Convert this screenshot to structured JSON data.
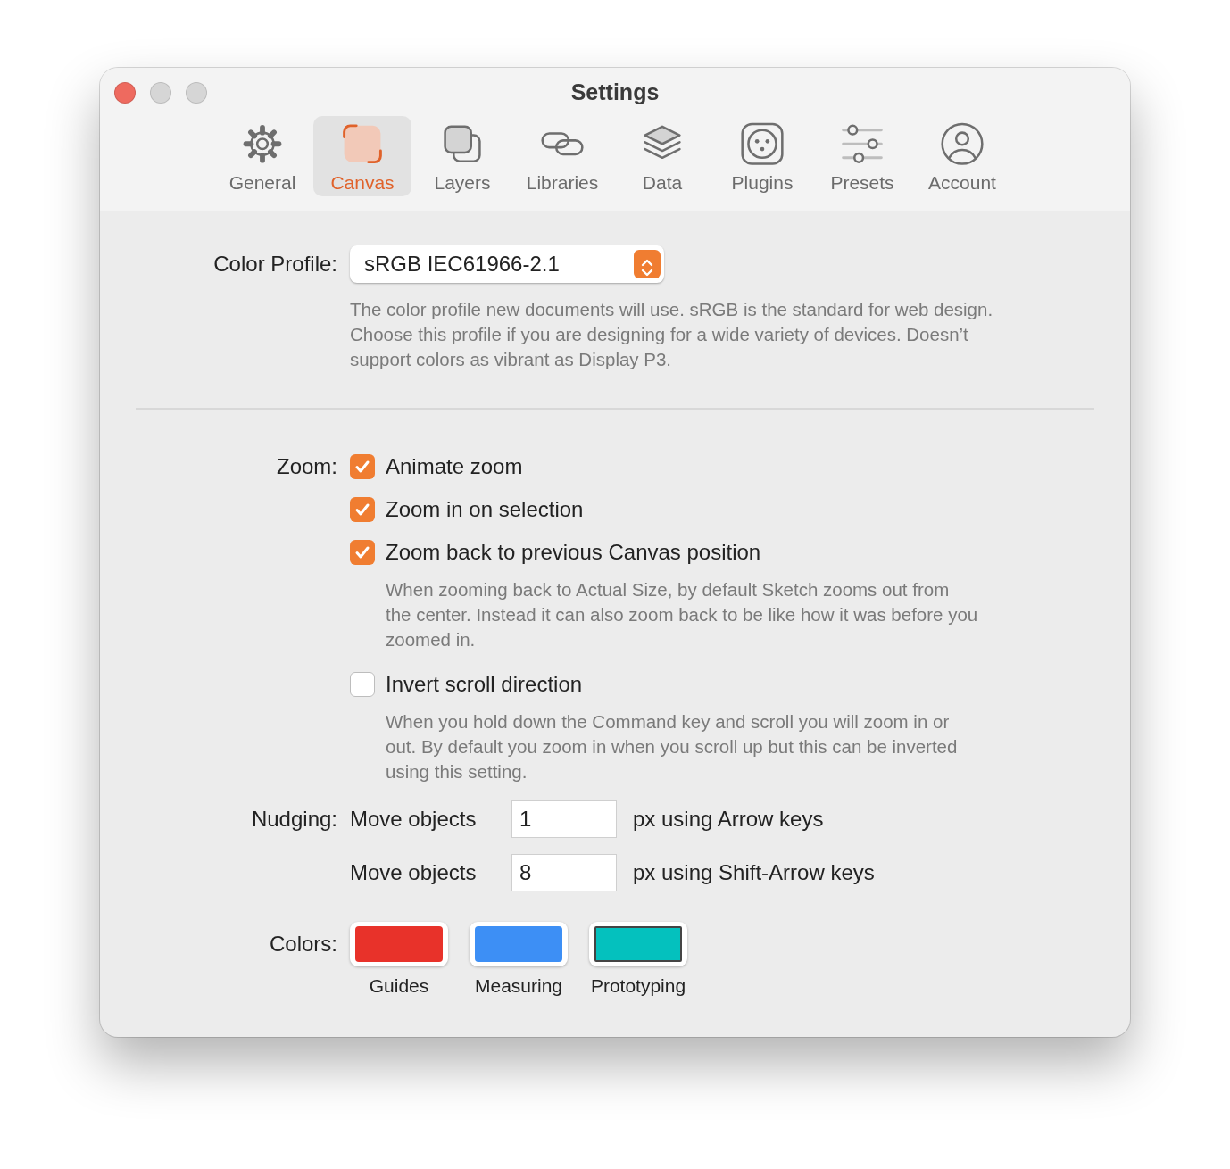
{
  "window": {
    "title": "Settings",
    "traffic_lights": [
      {
        "kind": "close",
        "disabled": false
      },
      {
        "kind": "minimize",
        "disabled": true
      },
      {
        "kind": "zoom",
        "disabled": true
      }
    ]
  },
  "tabs": [
    {
      "label": "General",
      "kind": "gear",
      "selected": false
    },
    {
      "label": "Canvas",
      "kind": "canvas",
      "selected": true
    },
    {
      "label": "Layers",
      "kind": "layers",
      "selected": false
    },
    {
      "label": "Libraries",
      "kind": "link",
      "selected": false
    },
    {
      "label": "Data",
      "kind": "stack",
      "selected": false
    },
    {
      "label": "Plugins",
      "kind": "plug",
      "selected": false
    },
    {
      "label": "Presets",
      "kind": "sliders",
      "selected": false
    },
    {
      "label": "Account",
      "kind": "person",
      "selected": false
    }
  ],
  "color_profile": {
    "label": "Color Profile:",
    "value": "sRGB IEC61966-2.1",
    "description": "The color profile new documents will use. sRGB is the standard for web design. Choose this profile if you are designing for a wide variety of devices. Doesn’t support colors as vibrant as Display P3."
  },
  "zoom": {
    "label": "Zoom:",
    "options": [
      {
        "label": "Animate zoom",
        "checked": true
      },
      {
        "label": "Zoom in on selection",
        "checked": true
      },
      {
        "label": "Zoom back to previous Canvas position",
        "checked": true,
        "description": "When zooming back to Actual Size, by default Sketch zooms out from the center. Instead it can also zoom back to be like how it was before you zoomed in."
      },
      {
        "label": "Invert scroll direction",
        "checked": false,
        "description": "When you hold down the Command key and scroll you will zoom in or out. By default you zoom in when you scroll up but this can be inverted using this setting."
      }
    ]
  },
  "nudging": {
    "label": "Nudging:",
    "rows": [
      {
        "prefix": "Move objects",
        "value": "1",
        "suffix": "px using Arrow keys"
      },
      {
        "prefix": "Move objects",
        "value": "8",
        "suffix": "px using Shift-Arrow keys"
      }
    ]
  },
  "colors": {
    "label": "Colors:",
    "swatches": [
      {
        "label": "Guides",
        "color": "#e8322a",
        "selected": false
      },
      {
        "label": "Measuring",
        "color": "#3d8ff5",
        "selected": false
      },
      {
        "label": "Prototyping",
        "color": "#04c1be",
        "selected": true
      }
    ]
  }
}
